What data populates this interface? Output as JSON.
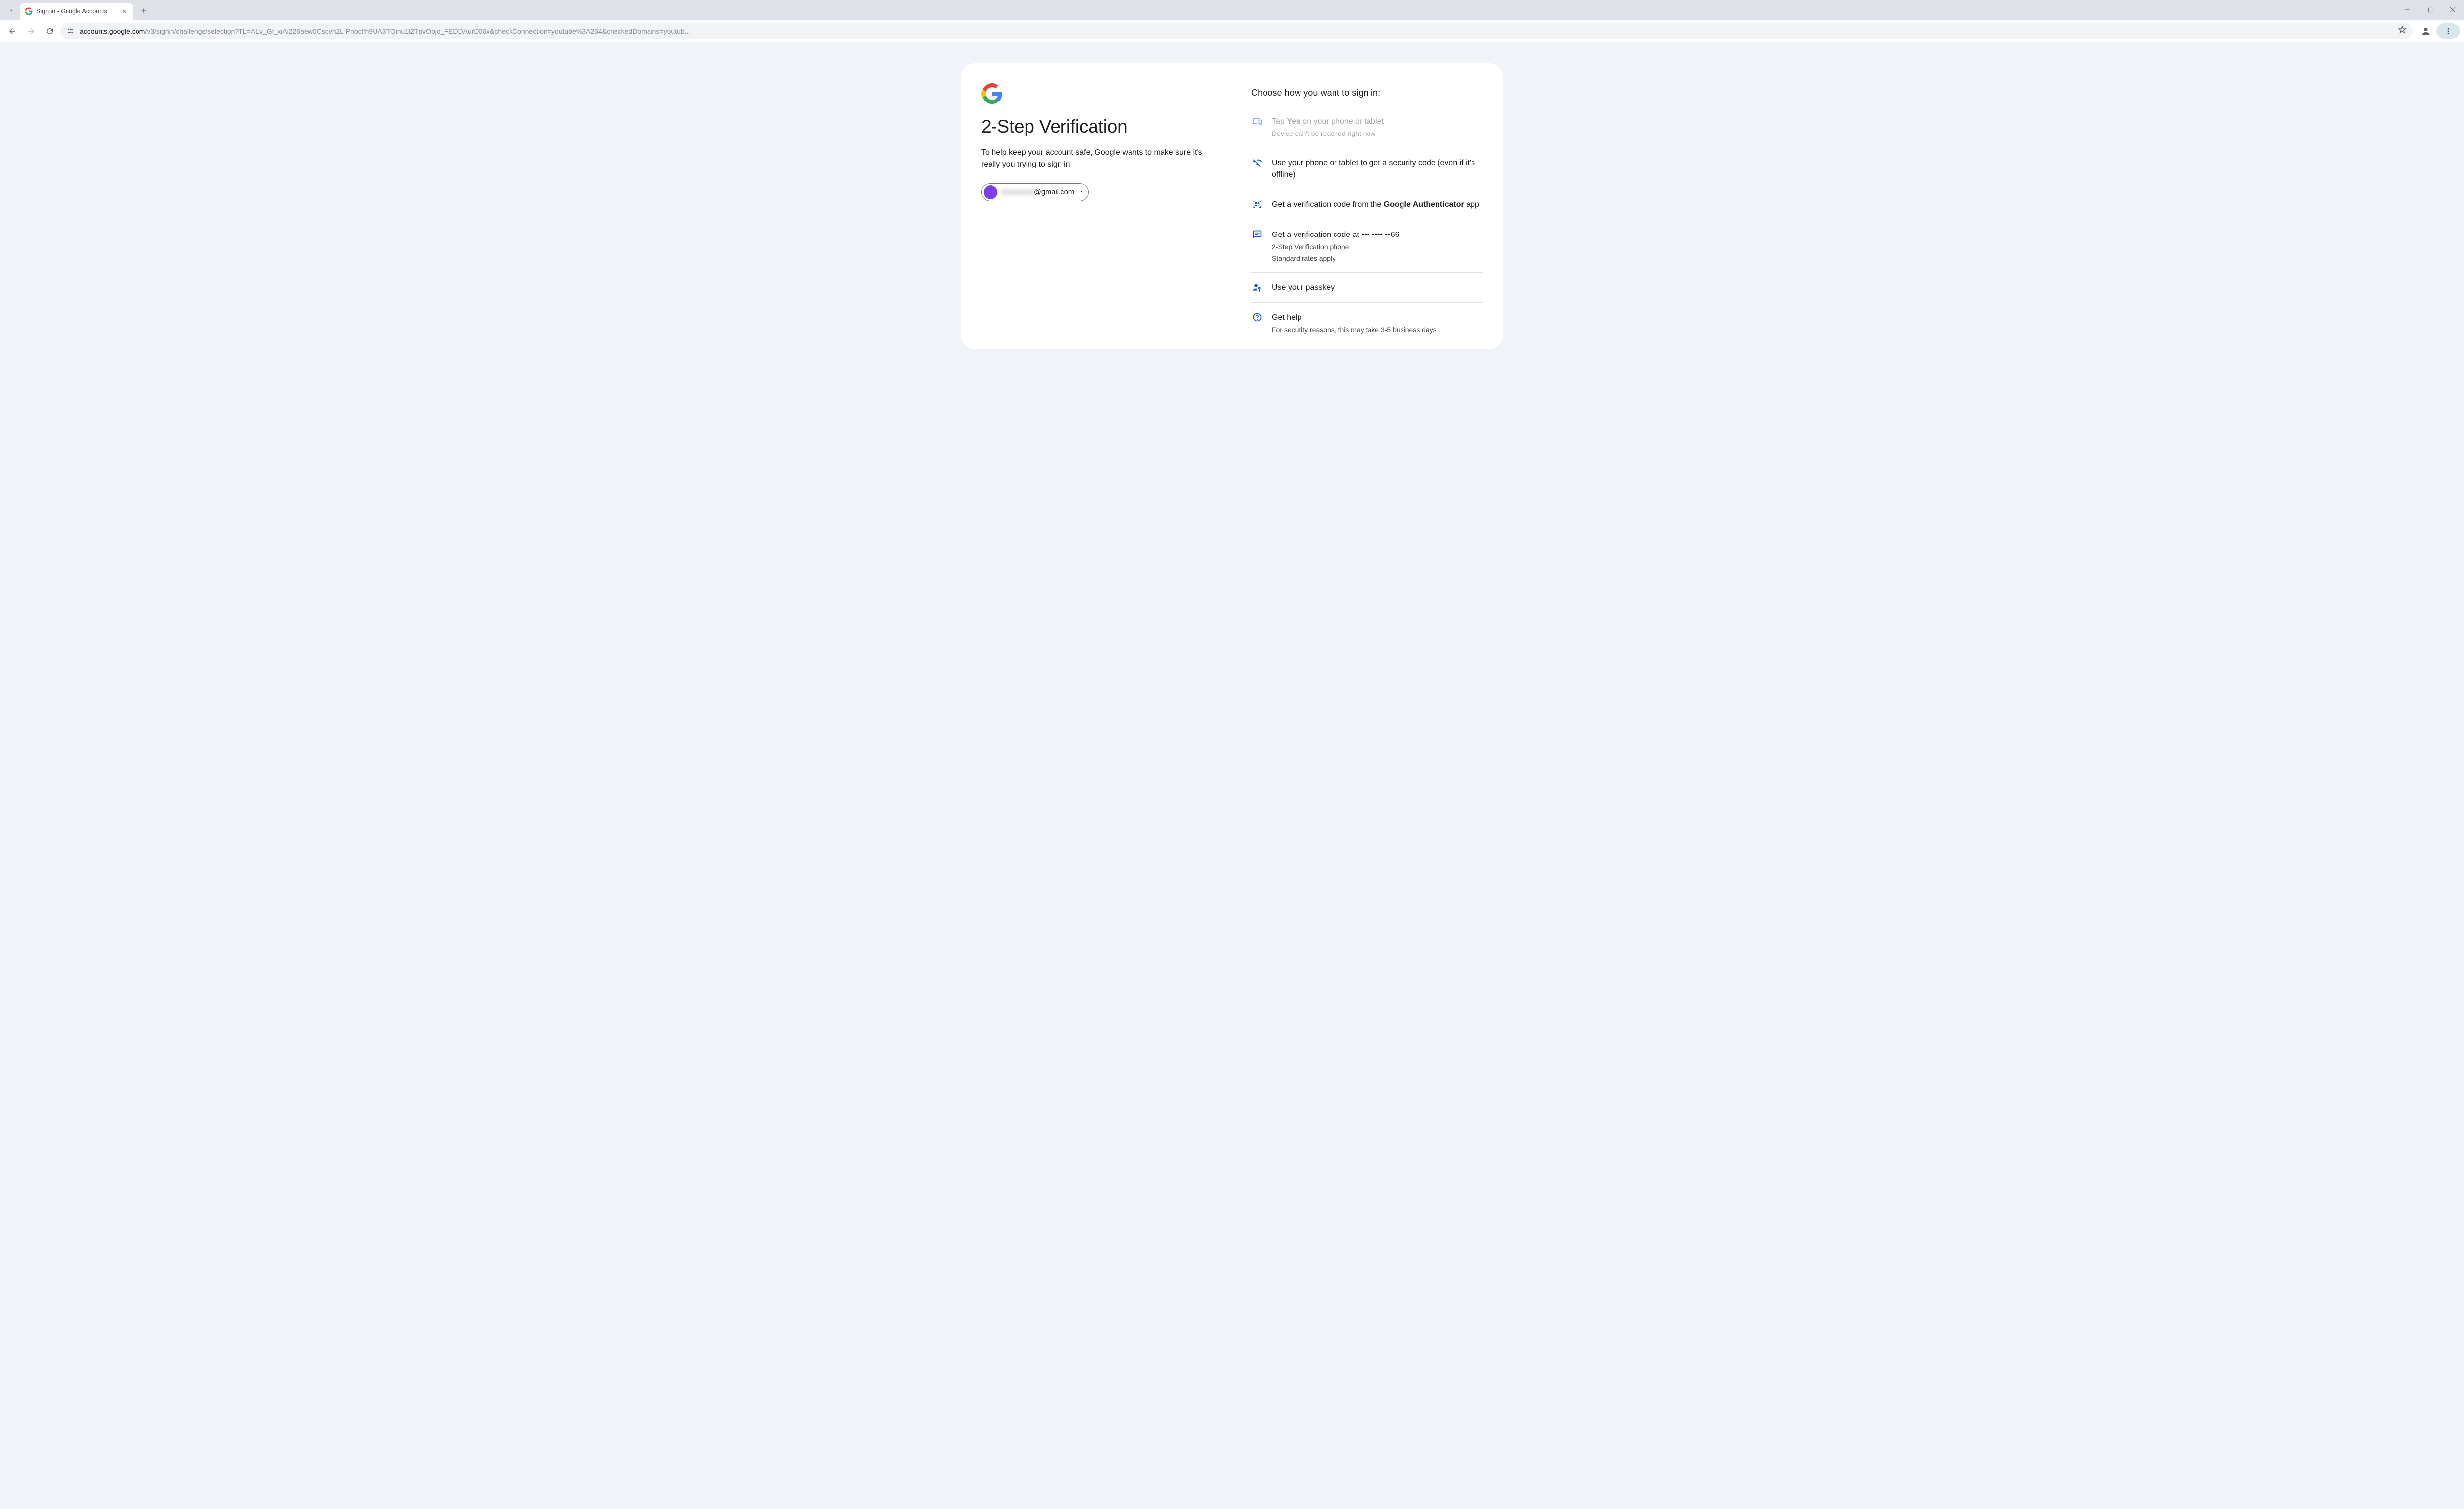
{
  "browser": {
    "tab_title": "Sign in - Google Accounts",
    "url_host": "accounts.google.com",
    "url_path": "/v3/signin/challenge/selection?TL=ALv_Gf_xiAi226aew0Cscvn2L-Pnbclfh9UA3TOinu1t2TpvObjo_FEDDAurD06x&checkConnection=youtube%3A264&checkedDomains=youtub…"
  },
  "page": {
    "heading": "2-Step Verification",
    "subtext": "To help keep your account safe, Google wants to make sure it's really you trying to sign in",
    "account_email_suffix": "@gmail.com",
    "choose_title": "Choose how you want to sign in:",
    "options": [
      {
        "line1_pre": "Tap ",
        "line1_bold": "Yes",
        "line1_post": " on your phone or tablet",
        "line2": "Device can't be reached right now"
      },
      {
        "line1": "Use your phone or tablet to get a security code (even if it's offline)"
      },
      {
        "line1_pre": "Get a verification code from the ",
        "line1_bold": "Google Authenticator",
        "line1_post": " app"
      },
      {
        "line1": "Get a verification code at ••• •••• ••66",
        "line2a": "2-Step Verification phone",
        "line2b": "Standard rates apply"
      },
      {
        "line1": "Use your passkey"
      },
      {
        "line1": "Get help",
        "line2": "For security reasons, this may take 3-5 business days"
      }
    ]
  }
}
